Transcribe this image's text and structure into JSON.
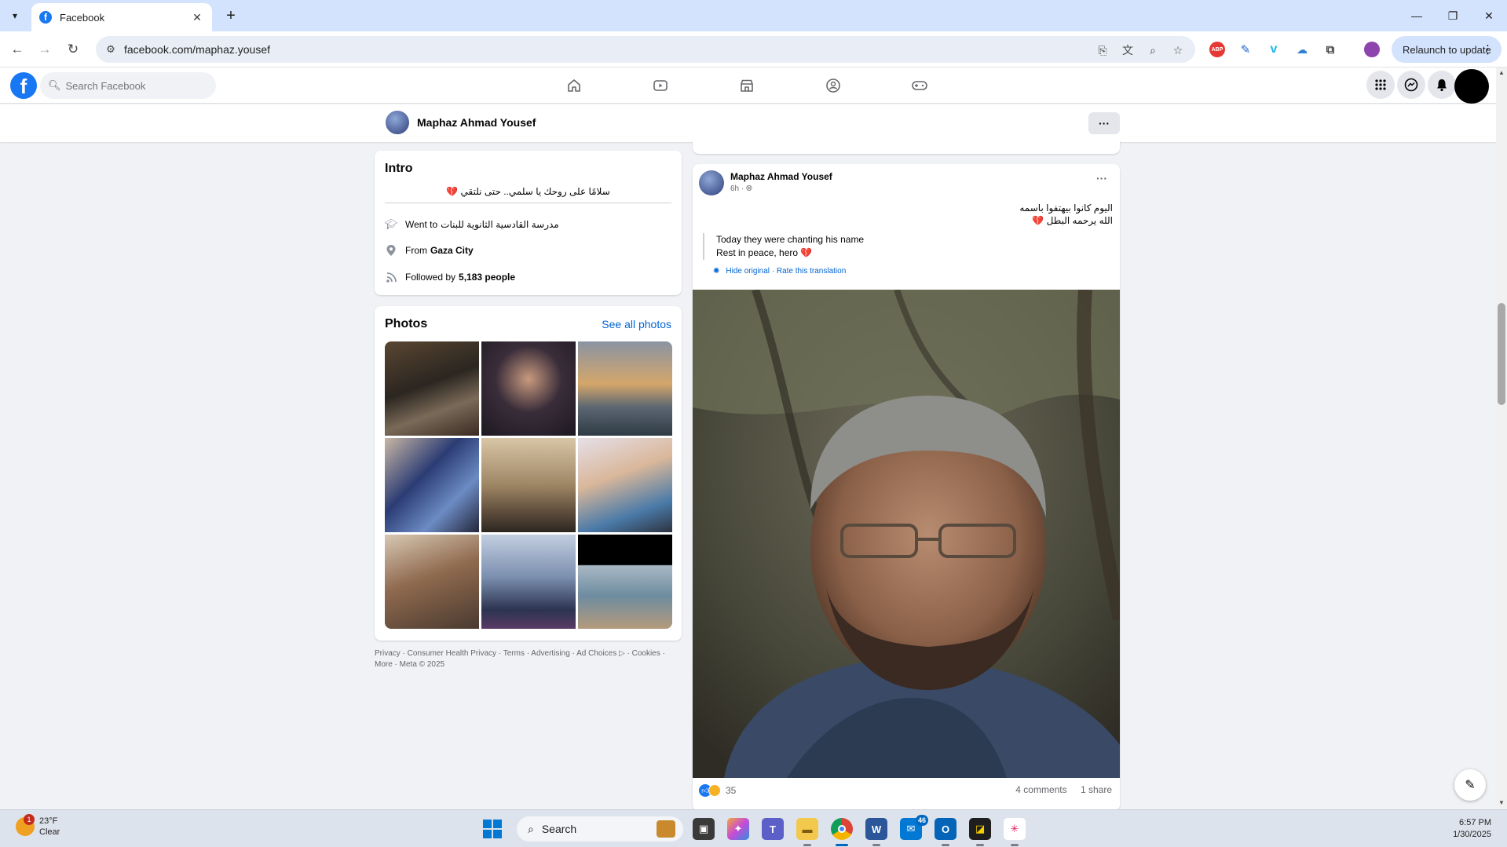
{
  "browser": {
    "tab_title": "Facebook",
    "url": "facebook.com/maphaz.yousef",
    "relaunch_label": "Relaunch to update",
    "extension_abp": "ABP"
  },
  "fb": {
    "search_placeholder": "Search Facebook"
  },
  "profile": {
    "name": "Maphaz Ahmad Yousef"
  },
  "intro": {
    "title": "Intro",
    "bio": "سلامًا على روحك يا سلمي.. حتى نلتقي 💔",
    "went_to_prefix": "Went to",
    "school": "مدرسة القادسية الثانوية للبنات",
    "from_prefix": "From",
    "city": "Gaza City",
    "followed_prefix": "Followed by",
    "followers": "5,183 people"
  },
  "photos": {
    "title": "Photos",
    "see_all": "See all photos"
  },
  "footer": {
    "line1": "Privacy · Consumer Health Privacy · Terms · Advertising · Ad Choices ▷ · Cookies ·",
    "line2": "More · Meta © 2025"
  },
  "post": {
    "author": "Maphaz Ahmad Yousef",
    "time": "6h · ",
    "text_ar_line1": "اليوم كانوا بيهتفوا باسمه",
    "text_ar_line2": "الله يرحمه البطل 💔",
    "translation_line1": "Today they were chanting his name",
    "translation_line2": "Rest in peace, hero 💔",
    "hide_original": "Hide original",
    "rate_translation": "Rate this translation",
    "separator": " · ",
    "reaction_count": "35",
    "comments": "4 comments",
    "shares": "1 share"
  },
  "taskbar": {
    "temperature": "23°F",
    "weather": "Clear",
    "weather_badge": "1",
    "search_label": "Search",
    "badge_46": "46",
    "time": "6:57 PM",
    "date": "1/30/2025"
  }
}
